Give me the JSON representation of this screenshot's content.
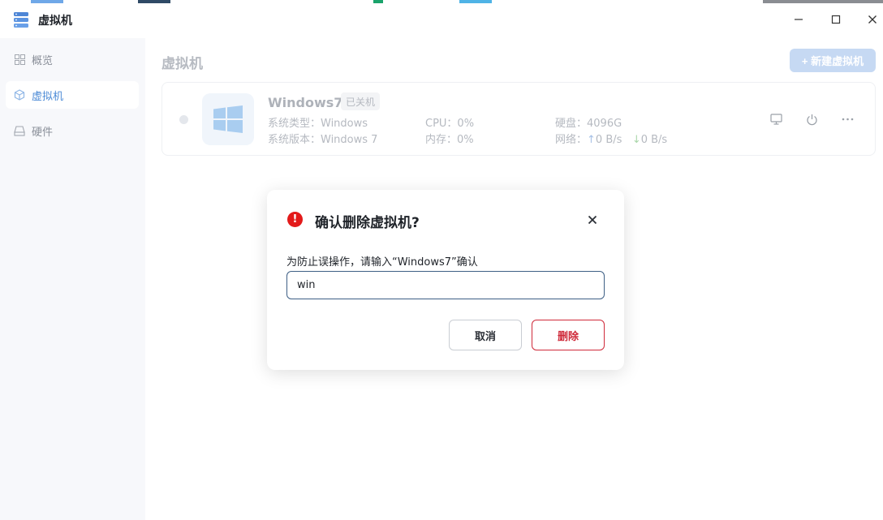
{
  "window": {
    "title": "虚拟机",
    "controls": [
      "minimize-icon",
      "maximize-icon",
      "close-icon"
    ]
  },
  "sidebar": {
    "items": [
      {
        "label": "概览",
        "icon": "grid-icon",
        "active": false
      },
      {
        "label": "虚拟机",
        "icon": "cube-icon",
        "active": true
      },
      {
        "label": "硬件",
        "icon": "drive-icon",
        "active": false
      }
    ]
  },
  "main": {
    "title": "虚拟机",
    "new_vm_button": "+ 新建虚拟机"
  },
  "vm": {
    "name": "Windows7",
    "status": "已关机",
    "type": "系统类型：Windows",
    "version": "系统版本：Windows 7",
    "cpu": "CPU：0%",
    "memory": "内存：0%",
    "disk": "硬盘：4096G",
    "network_label": "网络：",
    "net_up": "0 B/s",
    "net_down": "0 B/s",
    "actions": [
      "monitor-icon",
      "power-icon",
      "more-icon"
    ]
  },
  "dialog": {
    "title": "确认删除虚拟机?",
    "message": "为防止误操作，请输入“Windows7”确认",
    "input_value": "win",
    "cancel_label": "取消",
    "delete_label": "删除"
  },
  "colors": {
    "accent": "#4b8ad6",
    "danger": "#cf2a3a",
    "warning_icon": "#e31a1a"
  }
}
